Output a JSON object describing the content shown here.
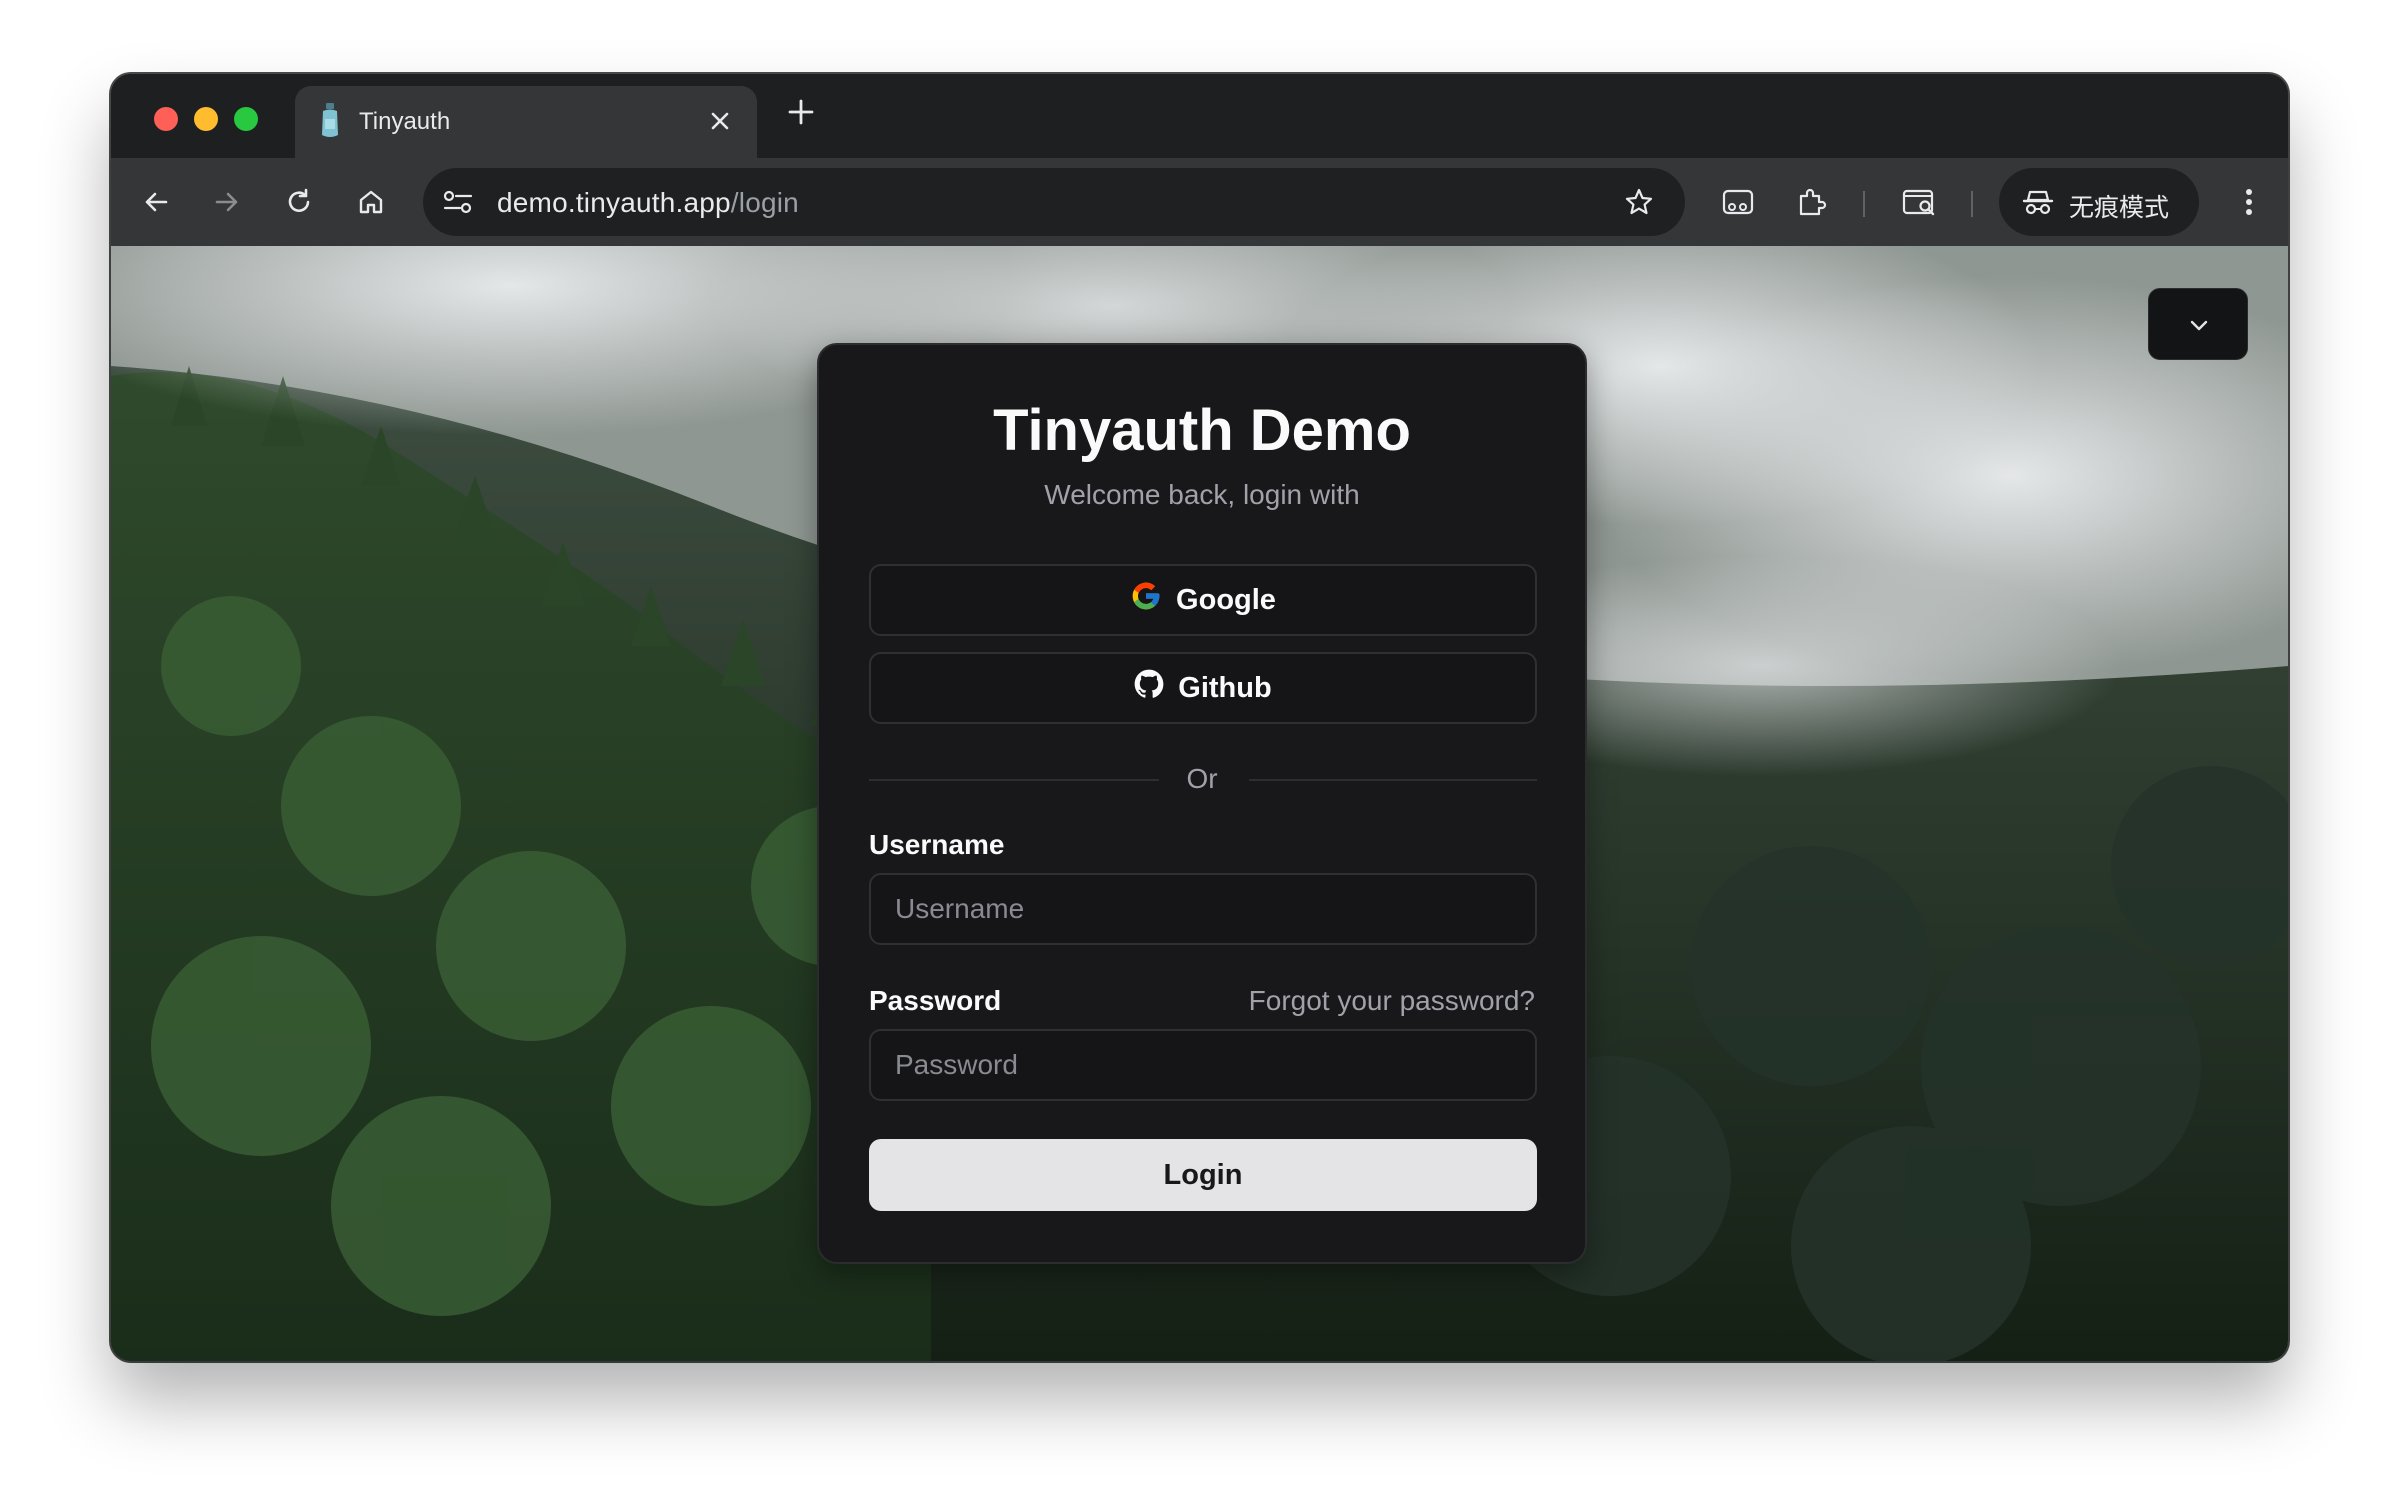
{
  "browser": {
    "tab": {
      "title": "Tinyauth"
    },
    "address_bar": {
      "host": "demo.tinyauth.app",
      "path": "/login"
    },
    "incognito_label": "无痕模式"
  },
  "login_card": {
    "title": "Tinyauth Demo",
    "subtitle": "Welcome back, login with",
    "google_button": "Google",
    "github_button": "Github",
    "divider": "Or",
    "username_label": "Username",
    "username_placeholder": "Username",
    "password_label": "Password",
    "password_placeholder": "Password",
    "forgot_password": "Forgot your password?",
    "login_button": "Login"
  },
  "icons": {
    "tab_favicon": "bottle-favicon-icon",
    "theme_toggle": "chevron-down-icon"
  },
  "colors": {
    "card_background": "#18181a",
    "login_button_background": "#e4e4e6",
    "browser_chrome": "#353638"
  }
}
